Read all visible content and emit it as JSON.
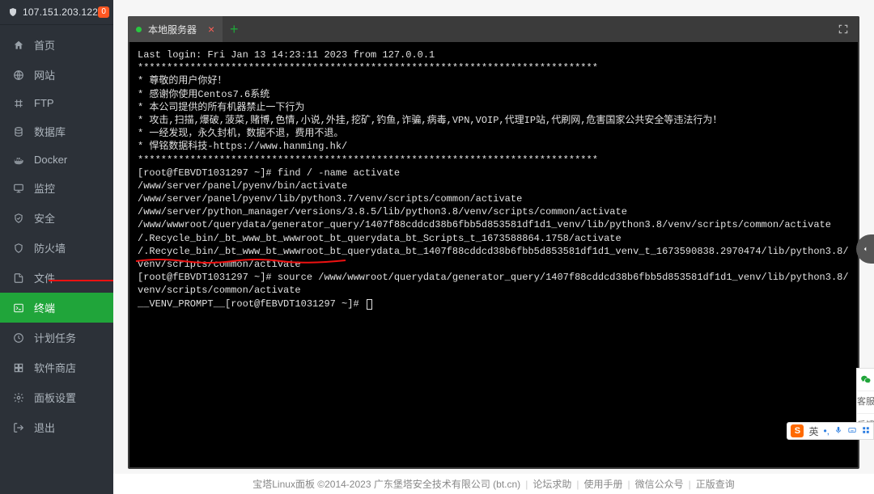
{
  "colors": {
    "accent": "#20a53a",
    "bg_dark": "#2c3138",
    "term_bg": "#000000"
  },
  "sidebar": {
    "ip": "107.151.203.122",
    "badge": "0",
    "items": [
      {
        "id": "home",
        "label": "首页"
      },
      {
        "id": "site",
        "label": "网站"
      },
      {
        "id": "ftp",
        "label": "FTP"
      },
      {
        "id": "db",
        "label": "数据库"
      },
      {
        "id": "docker",
        "label": "Docker"
      },
      {
        "id": "monitor",
        "label": "监控"
      },
      {
        "id": "security",
        "label": "安全"
      },
      {
        "id": "firewall",
        "label": "防火墙"
      },
      {
        "id": "files",
        "label": "文件"
      },
      {
        "id": "terminal",
        "label": "终端",
        "active": true
      },
      {
        "id": "cron",
        "label": "计划任务"
      },
      {
        "id": "store",
        "label": "软件商店"
      },
      {
        "id": "settings",
        "label": "面板设置"
      },
      {
        "id": "logout",
        "label": "退出"
      }
    ]
  },
  "tabs": {
    "items": [
      {
        "label": "本地服务器",
        "active": true
      }
    ]
  },
  "terminal": {
    "lines": [
      "Last login: Fri Jan 13 14:23:11 2023 from 127.0.0.1",
      "*******************************************************************************",
      "* 尊敬的用户你好！",
      "* 感谢你使用Centos7.6系统",
      "* 本公司提供的所有机器禁止一下行为",
      "* 攻击,扫描,爆破,菠菜,赌博,色情,小说,外挂,挖矿,钓鱼,诈骗,病毒,VPN,VOIP,代理IP站,代刷网,危害国家公共安全等违法行为！",
      "* 一经发现，永久封机，数据不退，费用不退。",
      "* 悍铭数据科技-https://www.hanming.hk/",
      "*******************************************************************************",
      "[root@fEBVDT1031297 ~]# find / -name activate",
      "/www/server/panel/pyenv/bin/activate",
      "/www/server/panel/pyenv/lib/python3.7/venv/scripts/common/activate",
      "/www/server/python_manager/versions/3.8.5/lib/python3.8/venv/scripts/common/activate",
      "/www/wwwroot/querydata/generator_query/1407f88cddcd38b6fbb5d853581df1d1_venv/lib/python3.8/venv/scripts/common/activate",
      "/.Recycle_bin/_bt_www_bt_wwwroot_bt_querydata_bt_Scripts_t_1673588864.1758/activate",
      "/.Recycle_bin/_bt_www_bt_wwwroot_bt_querydata_bt_1407f88cddcd38b6fbb5d853581df1d1_venv_t_1673590838.2970474/lib/python3.8/venv/scripts/common/activate",
      "[root@fEBVDT1031297 ~]# source /www/wwwroot/querydata/generator_query/1407f88cddcd38b6fbb5d853581df1d1_venv/lib/python3.8/venv/scripts/common/activate",
      "__VENV_PROMPT__[root@fEBVDT1031297 ~]# "
    ]
  },
  "footer": {
    "copyright": "宝塔Linux面板 ©2014-2023 广东堡塔安全技术有限公司 (bt.cn)",
    "links": [
      "论坛求助",
      "使用手册",
      "微信公众号",
      "正版查询"
    ]
  },
  "side_float": {
    "items": [
      {
        "id": "wechat",
        "kind": "icon"
      },
      {
        "id": "kefu",
        "label": "客服"
      },
      {
        "id": "fankui",
        "label": "反馈"
      }
    ]
  },
  "ime": {
    "logo": "S",
    "lang": "英"
  }
}
